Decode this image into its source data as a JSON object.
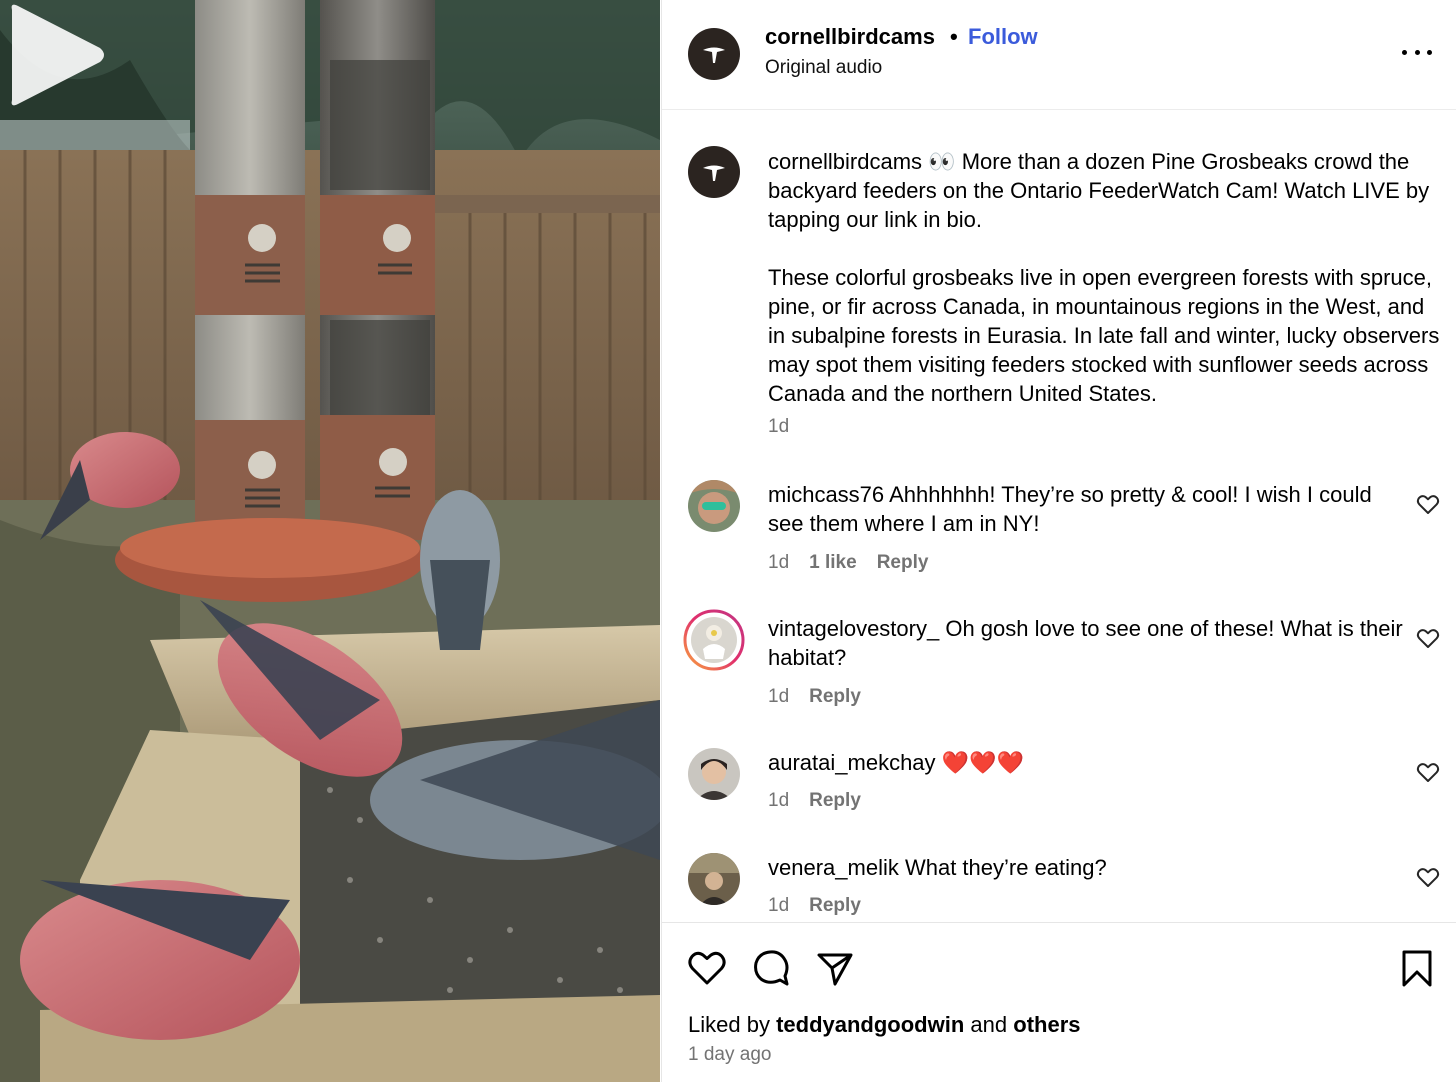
{
  "post": {
    "username": "cornellbirdcams",
    "separator": "•",
    "follow_label": "Follow",
    "audio_label": "Original audio"
  },
  "caption": {
    "username": "cornellbirdcams",
    "line1": "👀 More than a dozen Pine Grosbeaks crowd the backyard feeders on the Ontario FeederWatch Cam! Watch LIVE by tapping our link in bio.",
    "line2": "These colorful grosbeaks live in open evergreen forests with spruce, pine, or fir across Canada, in mountainous regions in the West, and in subalpine forests in Eurasia. In late fall and winter, lucky observers may spot them visiting feeders stocked with sunflower seeds across Canada and the northern United States.",
    "time": "1d"
  },
  "comments": [
    {
      "username": "michcass76",
      "text": "Ahhhhhhh! They’re so pretty & cool! I wish I could see them where I am in NY!",
      "time": "1d",
      "likes": "1 like",
      "reply": "Reply"
    },
    {
      "username": "vintagelovestory_",
      "text": "Oh gosh love to see one of these! What is their habitat?",
      "time": "1d",
      "reply": "Reply"
    },
    {
      "username": "auratai_mekchay",
      "text": "❤️❤️❤️",
      "time": "1d",
      "reply": "Reply"
    },
    {
      "username": "venera_melik",
      "text": "What they’re eating?",
      "time": "1d",
      "reply": "Reply"
    }
  ],
  "footer": {
    "liked_prefix": "Liked by",
    "liked_user": "teddyandgoodwin",
    "liked_and": "and",
    "liked_others": "others",
    "timestamp": "1 day ago"
  },
  "icons": {
    "like": "heart-icon",
    "comment": "comment-icon",
    "share": "share-icon",
    "save": "bookmark-icon",
    "more": "more-options-icon",
    "play": "play-icon"
  },
  "colors": {
    "follow": "#3b5bdb",
    "muted_text": "#737373",
    "divider": "#e6e6e6",
    "avatar_bg": "#2b2420"
  }
}
